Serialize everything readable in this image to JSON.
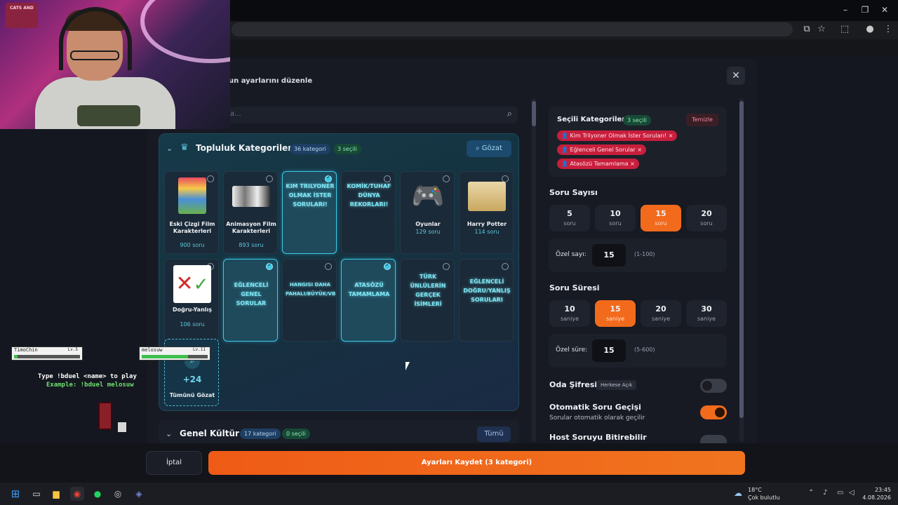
{
  "modal": {
    "subtitle": "un ayarlarını düzenle",
    "search_placeholder": "a..."
  },
  "community": {
    "title": "Topluluk Kategorileri",
    "count_badge": "36 kategori",
    "selected_badge": "3 seçili",
    "browse_label": "Gözat",
    "cards": [
      {
        "name": "Eski Çizgi Film Karakterleri",
        "count": "900 soru",
        "selected": false,
        "style": "image"
      },
      {
        "name": "Animasyon Film Karakterleri",
        "count": "893 soru",
        "selected": false,
        "style": "image"
      },
      {
        "name": "KIM TRILYONER OLMAK İSTER SORULARI!",
        "count": "",
        "selected": true,
        "style": "neon"
      },
      {
        "name": "KOMİK/TUHAF DÜNYA REKORLARI!",
        "count": "",
        "selected": false,
        "style": "neon"
      },
      {
        "name": "Oyunlar",
        "count": "129 soru",
        "selected": false,
        "style": "image"
      },
      {
        "name": "Harry Potter",
        "count": "114 soru",
        "selected": false,
        "style": "image"
      },
      {
        "name": "Doğru-Yanlış",
        "count": "106 soru",
        "selected": false,
        "style": "image"
      },
      {
        "name": "EĞLENCELİ GENEL SORULAR",
        "count": "",
        "selected": true,
        "style": "neon"
      },
      {
        "name": "HANGISI DAHA PAHALI/BÜYÜK/VB",
        "count": "",
        "selected": false,
        "style": "neon"
      },
      {
        "name": "ATASÖZÜ TAMAMLAMA",
        "count": "",
        "selected": true,
        "style": "neon"
      },
      {
        "name": "TÜRK ÜNLÜLERİN GERÇEK İSİMLERİ",
        "count": "",
        "selected": false,
        "style": "neon"
      },
      {
        "name": "EĞLENCELİ DOĞRU/YANLIŞ SORULARI",
        "count": "",
        "selected": false,
        "style": "neon"
      }
    ],
    "view_all_count": "+24",
    "view_all_label": "Tümünü Gözat"
  },
  "general": {
    "title": "Genel Kültür",
    "count_badge": "17 kategori",
    "selected_badge": "0 seçili",
    "all_label": "Tümü"
  },
  "selected_panel": {
    "title": "Seçili Kategoriler",
    "badge": "3 seçili",
    "clear_label": "Temizle",
    "tags": [
      "Kim Trilyoner Olmak İster Soruları!",
      "Eğlenceli Genel Sorular",
      "Atasözü Tamamlama"
    ]
  },
  "question_count": {
    "label": "Soru Sayısı",
    "unit": "soru",
    "options": [
      "5",
      "10",
      "15",
      "20"
    ],
    "selected": "15",
    "custom_label": "Özel sayı:",
    "custom_value": "15",
    "custom_range": "(1-100)"
  },
  "question_time": {
    "label": "Soru Süresi",
    "unit": "saniye",
    "options": [
      "10",
      "15",
      "20",
      "30"
    ],
    "selected": "15",
    "custom_label": "Özel süre:",
    "custom_value": "15",
    "custom_range": "(5-600)"
  },
  "room_password": {
    "label": "Oda Şifresi",
    "badge": "Herkese Açık",
    "enabled": false
  },
  "auto_advance": {
    "label": "Otomatik Soru Geçişi",
    "description": "Sorular otomatik olarak geçilir",
    "enabled": true
  },
  "host_finish": {
    "label": "Host Soruyu Bitirebilir",
    "enabled": false
  },
  "footer": {
    "cancel_label": "İptal",
    "save_label": "Ayarları Kaydet (3 kategori)"
  },
  "webcam_poster": "CATS AND",
  "game": {
    "player1": {
      "name": "TimoChin",
      "level": "Lv.5",
      "hp": 0.05
    },
    "player2": {
      "name": "melosuw",
      "level": "Lv.11",
      "hp": 0.7
    },
    "instruction": "Type !bduel <name> to play",
    "example": "Example: !bduel melosuw"
  },
  "taskbar": {
    "temperature": "18°C",
    "weather": "Çok bulutlu",
    "time": "23:45",
    "date": "4.08.2026"
  },
  "colors": {
    "accent": "#f26a1b",
    "selected_card": "#3cc8e8",
    "tag": "#c81e3c"
  }
}
